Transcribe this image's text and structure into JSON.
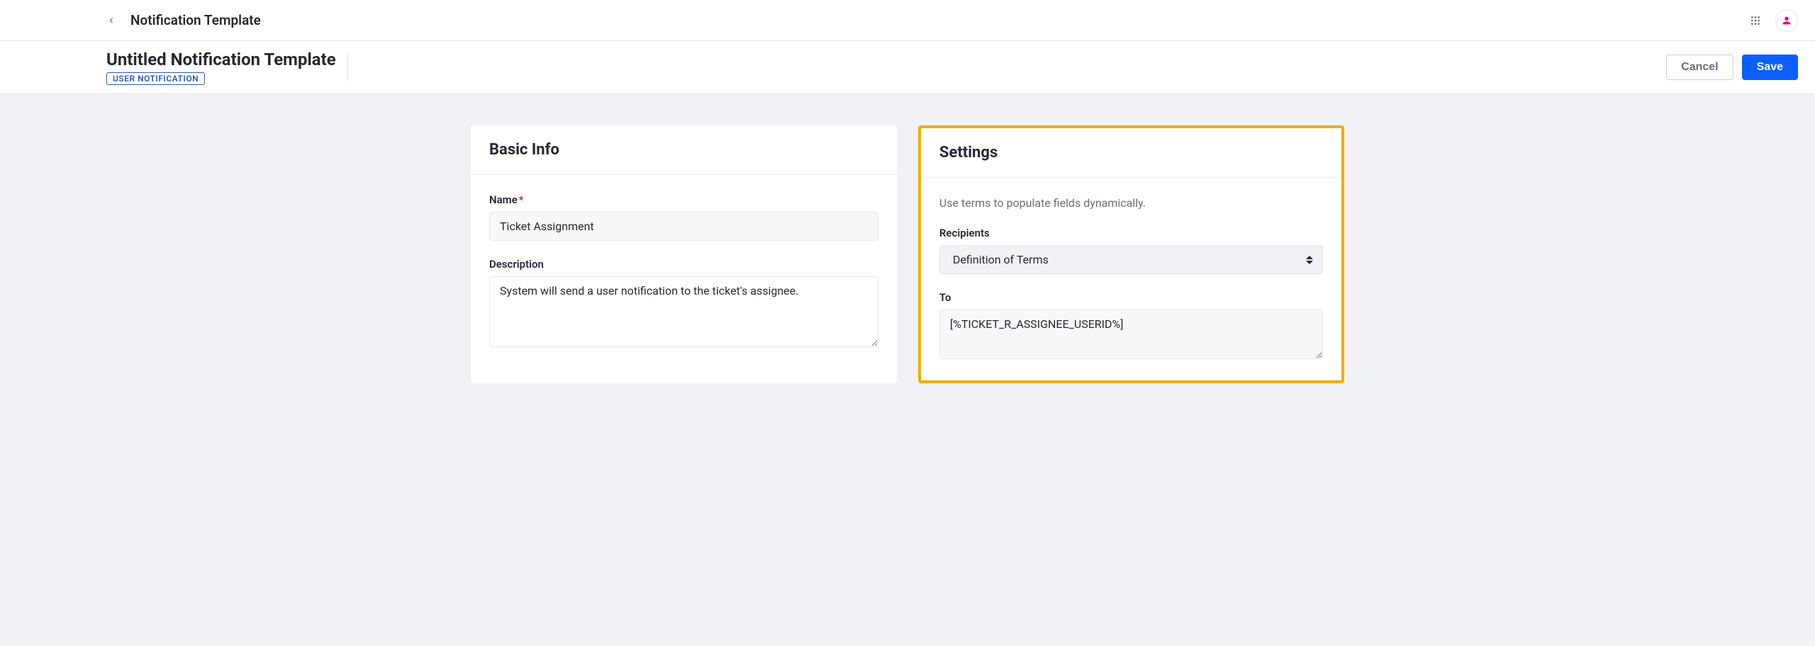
{
  "header": {
    "breadcrumb": "Notification Template"
  },
  "subheader": {
    "title": "Untitled Notification Template",
    "badge": "USER NOTIFICATION",
    "cancel_label": "Cancel",
    "save_label": "Save"
  },
  "basic_info": {
    "title": "Basic Info",
    "name_label": "Name",
    "name_value": "Ticket Assignment",
    "description_label": "Description",
    "description_value": "System will send a user notification to the ticket's assignee."
  },
  "settings": {
    "title": "Settings",
    "hint": "Use terms to populate fields dynamically.",
    "recipients_label": "Recipients",
    "recipients_value": "Definition of Terms",
    "to_label": "To",
    "to_value": "[%TICKET_R_ASSIGNEE_USERID%]"
  }
}
